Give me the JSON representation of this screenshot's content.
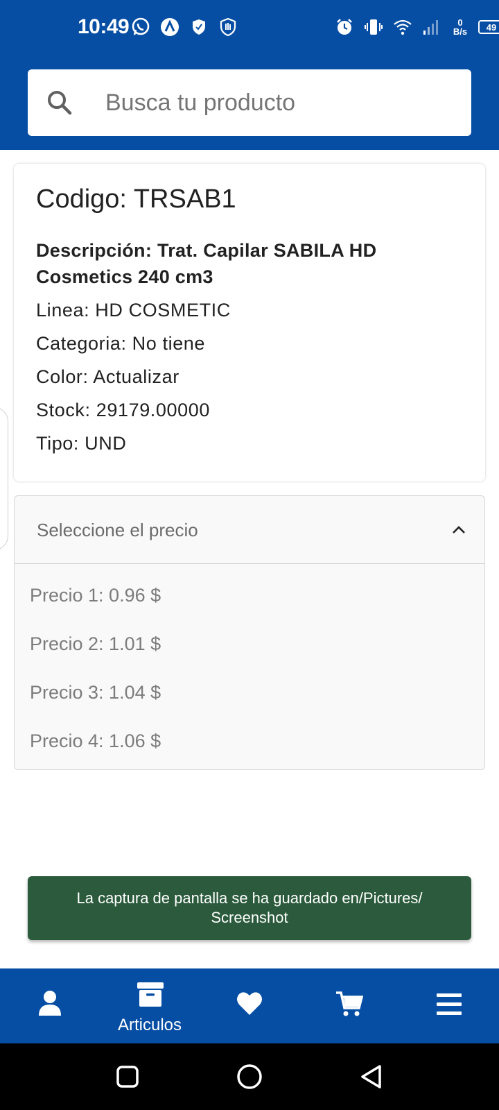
{
  "status_bar": {
    "time": "10:49",
    "net_speed_value": "0",
    "net_speed_unit": "B/s",
    "battery": "49"
  },
  "search": {
    "placeholder": "Busca tu producto",
    "icon": "search-icon"
  },
  "product": {
    "code": "Codigo: TRSAB1",
    "description": "Descripción: Trat. Capilar SABILA HD Cosmetics 240 cm3",
    "linea": "Linea: HD COSMETIC",
    "categoria": "Categoria: No tiene",
    "color": "Color: Actualizar",
    "stock": "Stock: 29179.00000",
    "tipo": "Tipo: UND"
  },
  "price_select": {
    "label": "Seleccione el precio",
    "expanded": true,
    "options": [
      "Precio 1: 0.96 $",
      "Precio 2: 1.01 $",
      "Precio 3: 1.04 $",
      "Precio 4: 1.06 $"
    ]
  },
  "toast": {
    "message": "La captura de pantalla se ha guardado en/Pictures/ Screenshot"
  },
  "bottom_nav": {
    "items": [
      {
        "icon": "user-icon",
        "label": ""
      },
      {
        "icon": "archive-box-icon",
        "label": "Articulos"
      },
      {
        "icon": "heart-icon",
        "label": ""
      },
      {
        "icon": "cart-icon",
        "label": ""
      },
      {
        "icon": "menu-icon",
        "label": ""
      }
    ]
  },
  "colors": {
    "brand_blue": "#064ea4",
    "toast_green": "#2b5b3c"
  }
}
